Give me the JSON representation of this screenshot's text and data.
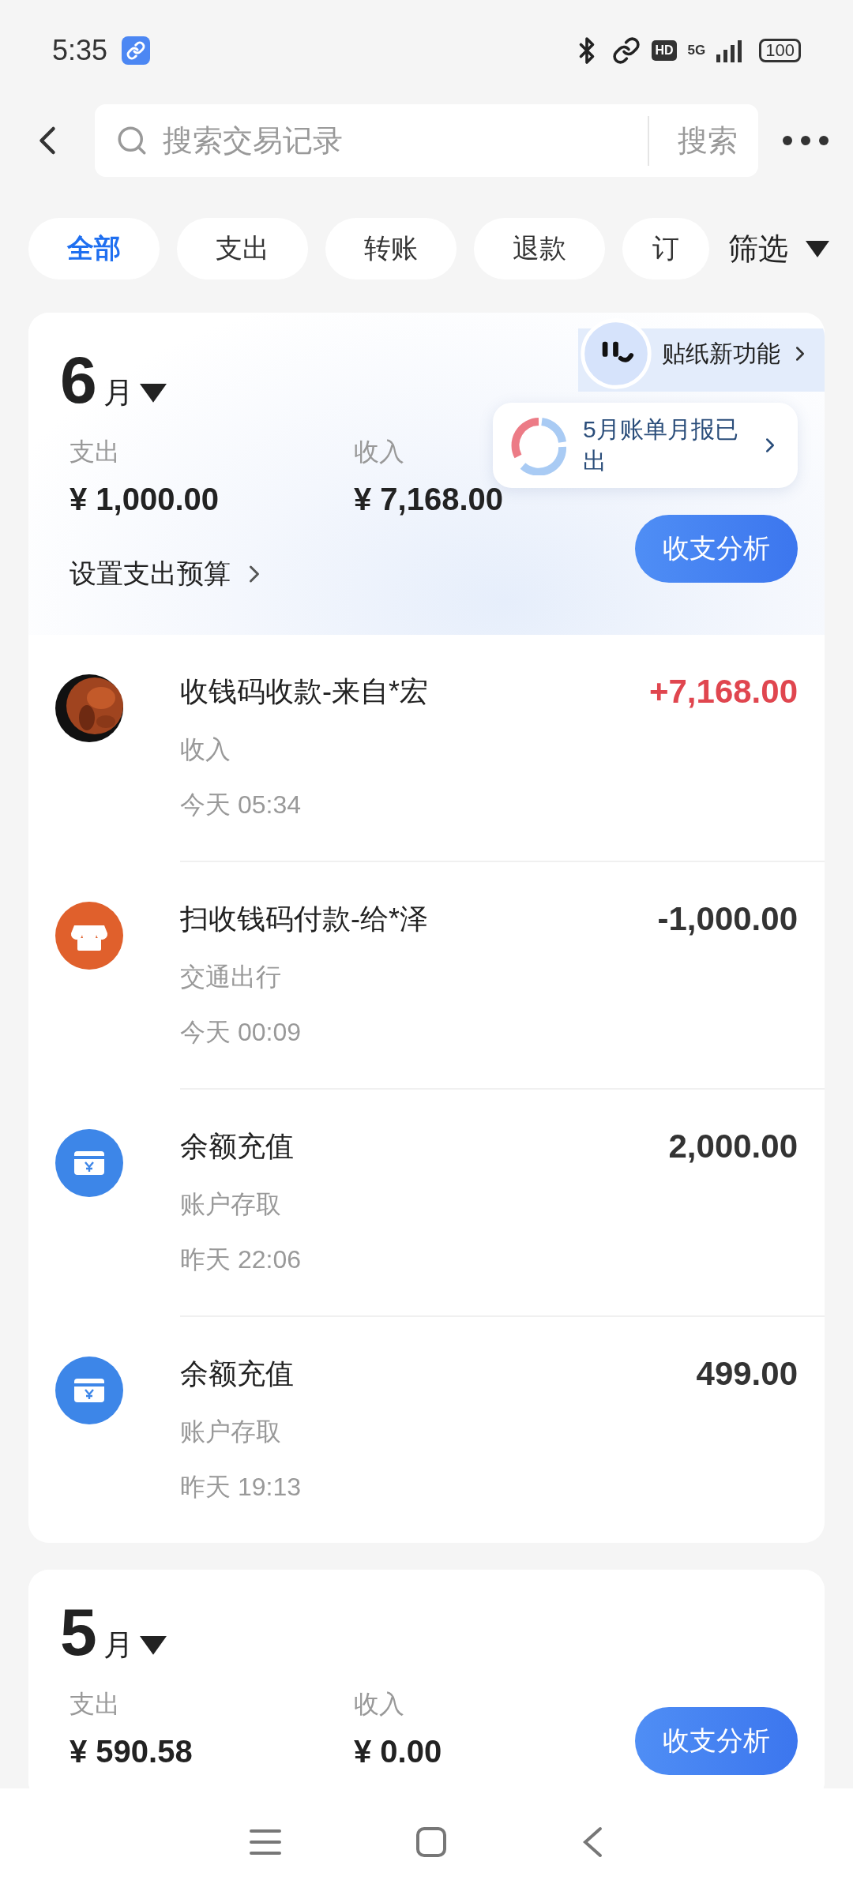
{
  "status_bar": {
    "time": "5:35",
    "hd": "HD",
    "network": "5G",
    "battery": "100"
  },
  "header": {
    "search": {
      "placeholder": "搜索交易记录"
    },
    "search_button": "搜索"
  },
  "filters": [
    {
      "label": "全部",
      "selected": true
    },
    {
      "label": "支出",
      "selected": false
    },
    {
      "label": "转账",
      "selected": false
    },
    {
      "label": "退款",
      "selected": false
    },
    {
      "label": "订",
      "selected": false
    }
  ],
  "filter_button": "筛选",
  "months": [
    {
      "month": "6",
      "unit": "月",
      "expense_label": "支出",
      "expense": "¥ 1,000.00",
      "income_label": "收入",
      "income": "¥ 7,168.00",
      "budget_link": "设置支出预算",
      "sticker_promo": "贴纸新功能",
      "report_bubble": "5月账单月报已出",
      "analysis_button": "收支分析",
      "transactions": [
        {
          "title": "收钱码收款-来自*宏",
          "category": "收入",
          "time": "今天 05:34",
          "amount": "+7,168.00",
          "income": true
        },
        {
          "kind": "store",
          "title": "扫收钱码付款-给*泽",
          "category": "交通出行",
          "time": "今天 00:09",
          "amount": "-1,000.00",
          "income": false
        },
        {
          "kind": "card",
          "title": "余额充值",
          "category": "账户存取",
          "time": "昨天 22:06",
          "amount": "2,000.00",
          "income": false
        },
        {
          "kind": "card",
          "title": "余额充值",
          "category": "账户存取",
          "time": "昨天 19:13",
          "amount": "499.00",
          "income": false
        }
      ]
    },
    {
      "month": "5",
      "unit": "月",
      "expense_label": "支出",
      "expense": "¥ 590.58",
      "income_label": "收入",
      "income": "¥ 0.00",
      "analysis_button": "收支分析"
    }
  ]
}
